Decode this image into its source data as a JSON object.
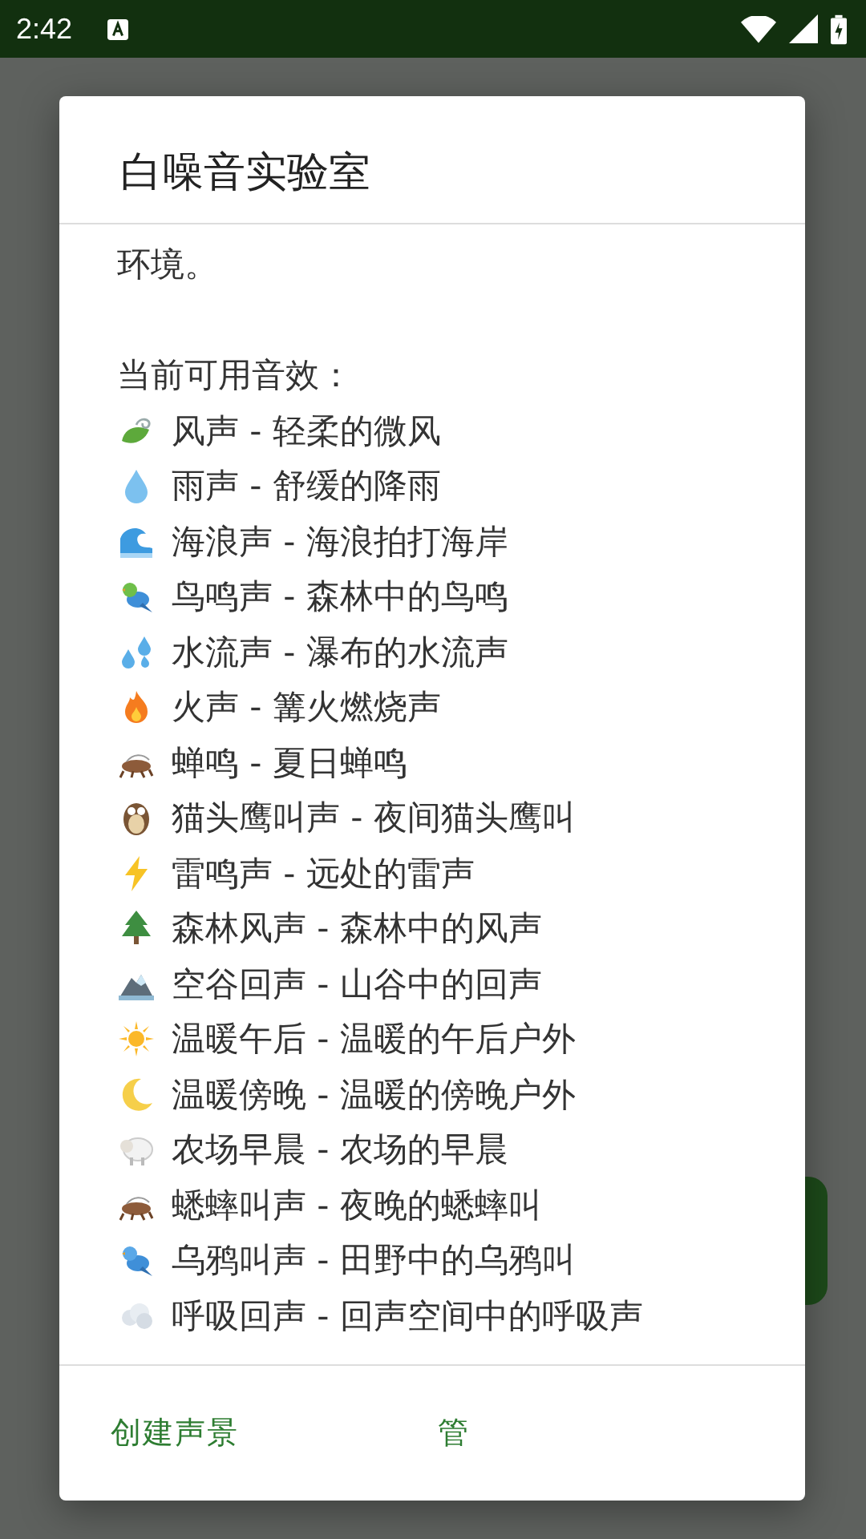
{
  "status_bar": {
    "time": "2:42"
  },
  "dialog": {
    "title": "白噪音实验室",
    "intro": "环境。",
    "list_heading": "当前可用音效：",
    "sounds": [
      "风声 - 轻柔的微风",
      "雨声 - 舒缓的降雨",
      "海浪声 - 海浪拍打海岸",
      "鸟鸣声 - 森林中的鸟鸣",
      "水流声 - 瀑布的水流声",
      "火声 - 篝火燃烧声",
      "蝉鸣 - 夏日蝉鸣",
      "猫头鹰叫声 - 夜间猫头鹰叫",
      "雷鸣声 - 远处的雷声",
      "森林风声 - 森林中的风声",
      "空谷回声 - 山谷中的回声",
      "温暖午后 - 温暖的午后户外",
      "温暖傍晚 - 温暖的傍晚户外",
      "农场早晨 - 农场的早晨",
      "蟋蟀叫声 - 夜晚的蟋蟀叫",
      "乌鸦叫声 - 田野中的乌鸦叫",
      "呼吸回声 - 回声空间中的呼吸声"
    ],
    "buttons": [
      "创建声景",
      "管"
    ]
  }
}
